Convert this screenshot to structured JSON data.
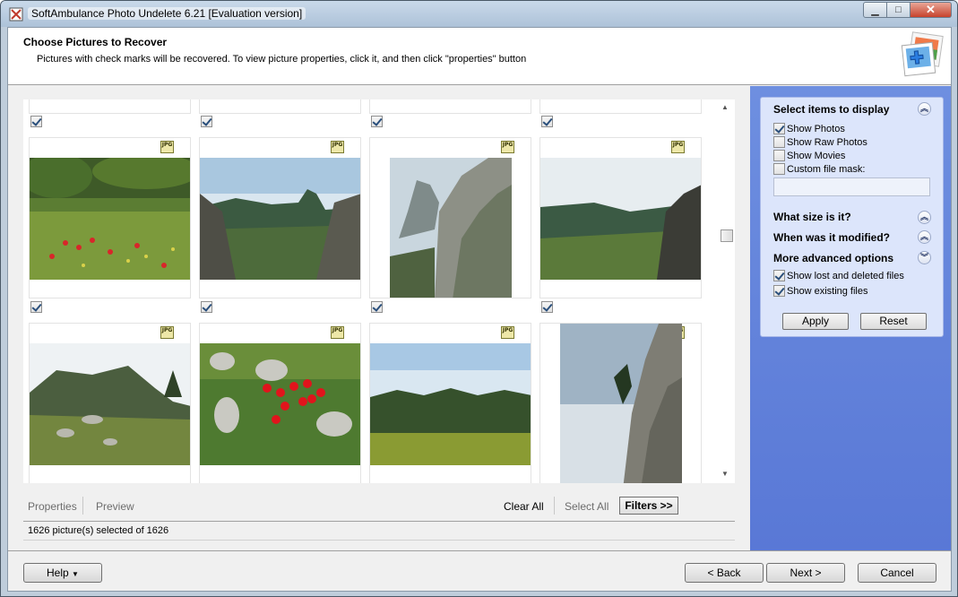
{
  "window": {
    "title": "SoftAmbulance Photo Undelete 6.21 [Evaluation version]"
  },
  "header": {
    "title": "Choose Pictures to Recover",
    "subtitle": "Pictures with check marks will be recovered. To view picture properties, click it, and then click \"properties\" button"
  },
  "gallery": {
    "file_badge": "JPG",
    "rows": [
      {
        "checked": [
          true,
          true,
          true,
          true
        ]
      },
      {
        "checked": [
          true,
          true,
          true,
          true
        ]
      }
    ]
  },
  "toolbar": {
    "properties": "Properties",
    "preview": "Preview",
    "clear_all": "Clear All",
    "select_all": "Select All",
    "filters": "Filters >>"
  },
  "status": {
    "text": "1626 picture(s) selected of 1626"
  },
  "filters_panel": {
    "display_heading": "Select items to display",
    "show_photos": "Show Photos",
    "show_raw_photos": "Show Raw Photos",
    "show_movies": "Show Movies",
    "custom_file_mask": "Custom file mask:",
    "custom_file_mask_value": "",
    "size_heading": "What size is it?",
    "modified_heading": "When was it modified?",
    "advanced_heading": "More advanced options",
    "show_lost_deleted": "Show lost and deleted files",
    "show_existing": "Show existing files",
    "apply": "Apply",
    "reset": "Reset",
    "checked": {
      "show_photos": true,
      "show_raw_photos": false,
      "show_movies": false,
      "custom_file_mask": false,
      "show_lost_deleted": true,
      "show_existing": true
    }
  },
  "footer": {
    "help": "Help",
    "back": "< Back",
    "next": "Next >",
    "cancel": "Cancel"
  },
  "colors": {
    "side_panel": "#5f7fdc",
    "panel_bg": "#dce5fb"
  }
}
